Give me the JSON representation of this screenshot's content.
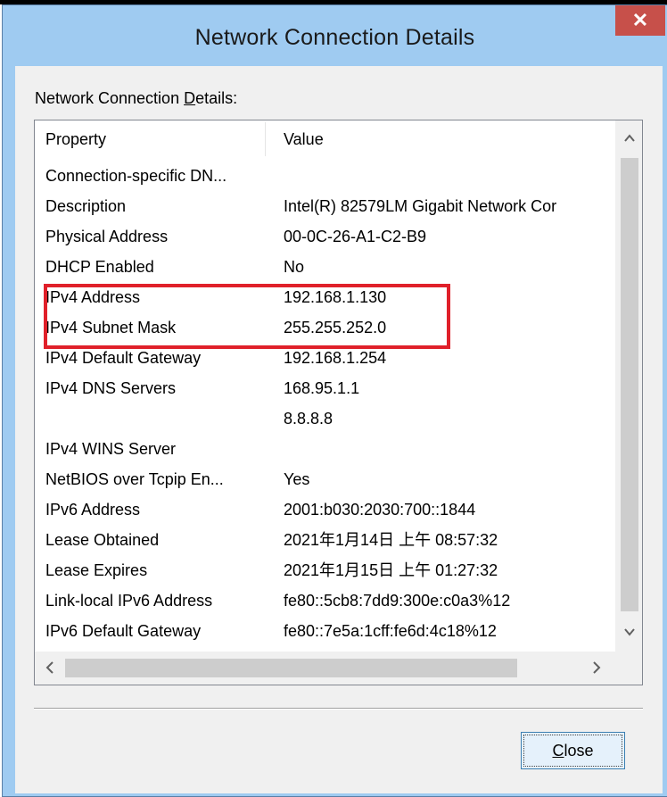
{
  "window": {
    "title": "Network Connection Details",
    "close_glyph": "✕",
    "group_label_pre": "Network Connection ",
    "group_label_mnemonic": "D",
    "group_label_post": "etails:"
  },
  "list": {
    "columns": [
      "Property",
      "Value"
    ],
    "rows": [
      {
        "property": "Connection-specific DN...",
        "value": ""
      },
      {
        "property": "Description",
        "value": "Intel(R) 82579LM Gigabit Network Cor"
      },
      {
        "property": "Physical Address",
        "value": "00-0C-26-A1-C2-B9"
      },
      {
        "property": "DHCP Enabled",
        "value": "No"
      },
      {
        "property": "IPv4 Address",
        "value": "192.168.1.130"
      },
      {
        "property": "IPv4 Subnet Mask",
        "value": "255.255.252.0"
      },
      {
        "property": "IPv4 Default Gateway",
        "value": "192.168.1.254"
      },
      {
        "property": "IPv4 DNS Servers",
        "value": "168.95.1.1"
      },
      {
        "property": "",
        "value": "8.8.8.8"
      },
      {
        "property": "IPv4 WINS Server",
        "value": ""
      },
      {
        "property": "NetBIOS over Tcpip En...",
        "value": "Yes"
      },
      {
        "property": "IPv6 Address",
        "value": "2001:b030:2030:700::1844"
      },
      {
        "property": "Lease Obtained",
        "value": "2021年1月14日 上午 08:57:32"
      },
      {
        "property": "Lease Expires",
        "value": "2021年1月15日 上午 01:27:32"
      },
      {
        "property": "Link-local IPv6 Address",
        "value": "fe80::5cb8:7dd9:300e:c0a3%12"
      },
      {
        "property": "IPv6 Default Gateway",
        "value": "fe80::7e5a:1cff:fe6d:4c18%12"
      }
    ]
  },
  "close_button": {
    "mnemonic": "C",
    "rest": "lose"
  },
  "highlight_color": "#e0202a",
  "icons": {
    "scroll_up": "chevron-up-icon",
    "scroll_down": "chevron-down-icon",
    "scroll_left": "chevron-left-icon",
    "scroll_right": "chevron-right-icon"
  }
}
